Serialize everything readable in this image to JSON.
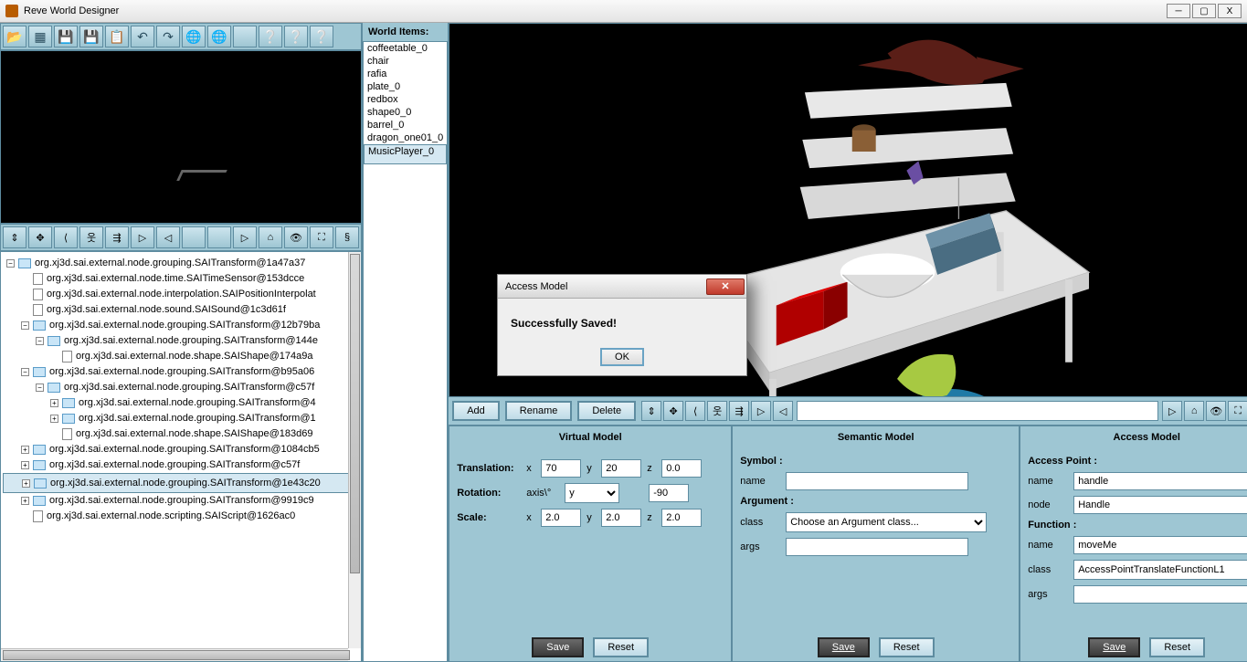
{
  "window": {
    "title": "Reve World Designer",
    "min": "─",
    "max": "▢",
    "close": "X"
  },
  "toolbar": [
    {
      "name": "open-folder-icon"
    },
    {
      "name": "new-scene-icon"
    },
    {
      "name": "save-icon"
    },
    {
      "name": "save-as-icon"
    },
    {
      "name": "clipboard-icon"
    },
    {
      "name": "undo-icon"
    },
    {
      "name": "redo-icon"
    },
    {
      "name": "globe-1-icon"
    },
    {
      "name": "globe-2-icon"
    },
    {
      "name": "blank-icon"
    },
    {
      "name": "help-1-icon"
    },
    {
      "name": "help-2-icon"
    },
    {
      "name": "help-3-icon"
    }
  ],
  "navbar": [
    {
      "name": "nav-examine-icon",
      "g": "⇕"
    },
    {
      "name": "nav-pan-icon",
      "g": "✥"
    },
    {
      "name": "nav-back-icon",
      "g": "⟨"
    },
    {
      "name": "nav-walk-icon",
      "g": "웃"
    },
    {
      "name": "nav-fly-icon",
      "g": "⇶"
    },
    {
      "name": "nav-play-icon",
      "g": "▷"
    },
    {
      "name": "nav-prev-icon",
      "g": "◁"
    },
    {
      "name": "nav-empty1",
      "g": ""
    },
    {
      "name": "nav-empty2",
      "g": ""
    },
    {
      "name": "nav-next-icon",
      "g": "▷"
    },
    {
      "name": "nav-home-icon",
      "g": "⌂"
    },
    {
      "name": "nav-find-icon",
      "g": "👁"
    },
    {
      "name": "nav-fit-icon",
      "g": "⛶"
    },
    {
      "name": "nav-extra-icon",
      "g": "§"
    }
  ],
  "tree": [
    {
      "ind": 0,
      "t": "-",
      "ic": "folder",
      "label": "org.xj3d.sai.external.node.grouping.SAITransform@1a47a37"
    },
    {
      "ind": 1,
      "t": "",
      "ic": "file",
      "label": "org.xj3d.sai.external.node.time.SAITimeSensor@153dcce"
    },
    {
      "ind": 1,
      "t": "",
      "ic": "file",
      "label": "org.xj3d.sai.external.node.interpolation.SAIPositionInterpolat"
    },
    {
      "ind": 1,
      "t": "",
      "ic": "file",
      "label": "org.xj3d.sai.external.node.sound.SAISound@1c3d61f"
    },
    {
      "ind": 1,
      "t": "-",
      "ic": "folder",
      "label": "org.xj3d.sai.external.node.grouping.SAITransform@12b79ba"
    },
    {
      "ind": 2,
      "t": "-",
      "ic": "folder",
      "label": "org.xj3d.sai.external.node.grouping.SAITransform@144e"
    },
    {
      "ind": 3,
      "t": "",
      "ic": "file",
      "label": "org.xj3d.sai.external.node.shape.SAIShape@174a9a"
    },
    {
      "ind": 1,
      "t": "-",
      "ic": "folder",
      "label": "org.xj3d.sai.external.node.grouping.SAITransform@b95a06"
    },
    {
      "ind": 2,
      "t": "-",
      "ic": "folder",
      "label": "org.xj3d.sai.external.node.grouping.SAITransform@c57f"
    },
    {
      "ind": 3,
      "t": "+",
      "ic": "folder",
      "label": "org.xj3d.sai.external.node.grouping.SAITransform@4"
    },
    {
      "ind": 3,
      "t": "+",
      "ic": "folder",
      "label": "org.xj3d.sai.external.node.grouping.SAITransform@1"
    },
    {
      "ind": 3,
      "t": "",
      "ic": "file",
      "label": "org.xj3d.sai.external.node.shape.SAIShape@183d69"
    },
    {
      "ind": 1,
      "t": "+",
      "ic": "folder",
      "label": "org.xj3d.sai.external.node.grouping.SAITransform@1084cb5"
    },
    {
      "ind": 1,
      "t": "+",
      "ic": "folder",
      "label": "org.xj3d.sai.external.node.grouping.SAITransform@c57f"
    },
    {
      "ind": 1,
      "t": "+",
      "ic": "folder",
      "label": "org.xj3d.sai.external.node.grouping.SAITransform@1e43c20",
      "sel": true
    },
    {
      "ind": 1,
      "t": "+",
      "ic": "folder",
      "label": "org.xj3d.sai.external.node.grouping.SAITransform@9919c9"
    },
    {
      "ind": 1,
      "t": "",
      "ic": "file",
      "label": "org.xj3d.sai.external.node.scripting.SAIScript@1626ac0"
    }
  ],
  "world": {
    "header": "World Items:",
    "items": [
      "coffeetable_0",
      "chair",
      "rafia",
      "plate_0",
      "redbox",
      "shape0_0",
      "barrel_0",
      "dragon_one01_0",
      "MusicPlayer_0"
    ],
    "selected": 8
  },
  "actions": {
    "add": "Add",
    "rename": "Rename",
    "delete": "Delete"
  },
  "navbar2": [
    {
      "name": "nav2-examine-icon",
      "g": "⇕"
    },
    {
      "name": "nav2-pan-icon",
      "g": "✥"
    },
    {
      "name": "nav2-back-icon",
      "g": "⟨"
    },
    {
      "name": "nav2-walk-icon",
      "g": "웃"
    },
    {
      "name": "nav2-fly-icon",
      "g": "⇶"
    },
    {
      "name": "nav2-play-icon",
      "g": "▷"
    },
    {
      "name": "nav2-prev-icon",
      "g": "◁"
    }
  ],
  "navbar2_right": [
    {
      "name": "nav2-next-icon",
      "g": "▷"
    },
    {
      "name": "nav2-home-icon",
      "g": "⌂"
    },
    {
      "name": "nav2-find-icon",
      "g": "👁"
    },
    {
      "name": "nav2-fit-icon",
      "g": "⛶"
    },
    {
      "name": "nav2-extra-icon",
      "g": "§"
    }
  ],
  "virtual": {
    "title": "Virtual Model",
    "translation_label": "Translation:",
    "rotation_label": "Rotation:",
    "scale_label": "Scale:",
    "x": "x",
    "y": "y",
    "z": "z",
    "axis": "axis\\°",
    "tx": "70",
    "ty": "20",
    "tz": "0.0",
    "raxis": "y",
    "rval": "-90",
    "sx": "2.0",
    "sy": "2.0",
    "sz": "2.0",
    "save": "Save",
    "reset": "Reset"
  },
  "semantic": {
    "title": "Semantic Model",
    "symbol": "Symbol :",
    "name_l": "name",
    "name_v": "",
    "argument": "Argument :",
    "class_l": "class",
    "class_v": "Choose an Argument class...",
    "args_l": "args",
    "args_v": "",
    "save": "Save",
    "reset": "Reset"
  },
  "access": {
    "title": "Access Model",
    "ap": "Access Point :",
    "name_l": "name",
    "name_v": "handle",
    "node_l": "node",
    "node_v": "Handle",
    "fn": "Function :",
    "fname_l": "name",
    "fname_v": "moveMe",
    "fclass_l": "class",
    "fclass_v": "AccessPointTranslateFunctionL1",
    "fargs_l": "args",
    "fargs_v": "",
    "save": "Save",
    "reset": "Reset"
  },
  "dialog": {
    "title": "Access Model",
    "msg": "Successfully Saved!",
    "ok": "OK"
  }
}
